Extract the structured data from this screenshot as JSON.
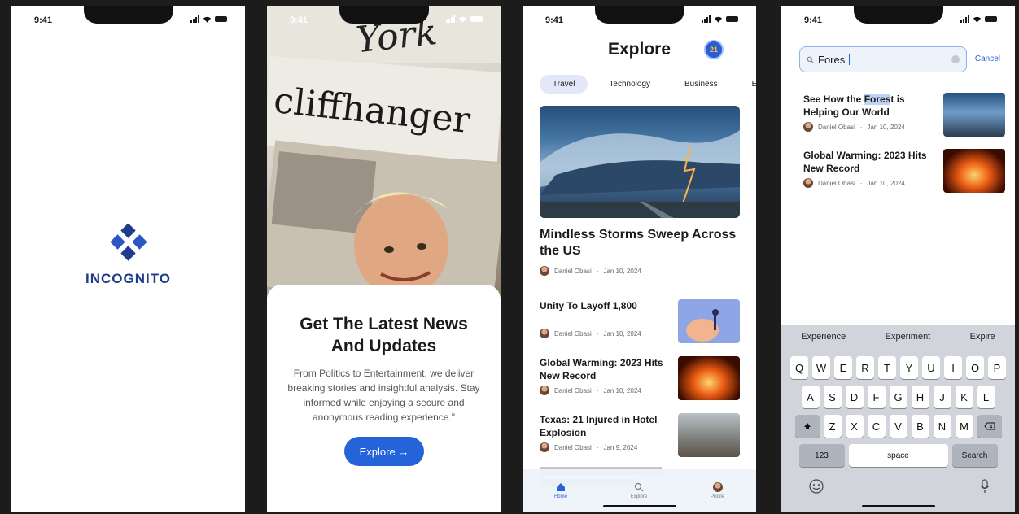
{
  "status": {
    "time": "9:41"
  },
  "splash": {
    "brand": "INCOGNITO",
    "brand_color": "#1f3b8c"
  },
  "onboarding": {
    "headline": "Get The Latest News And Updates",
    "body": "From Politics to Entertainment, we deliver breaking stories and insightful analysis. Stay informed while enjoying a secure and anonymous reading experience.\"",
    "cta_label": "Explore →",
    "paper_words": [
      "cliffhanger",
      "York"
    ]
  },
  "explore": {
    "title": "Explore",
    "badge": "21",
    "tabs": [
      "Travel",
      "Technology",
      "Business",
      "E"
    ],
    "hero": {
      "title": "Mindless Storms Sweep Across the US",
      "author": "Daniel Obasi",
      "date": "Jan 10, 2024"
    },
    "articles": [
      {
        "title": "Unity To Layoff 1,800",
        "author": "Daniel Obasi",
        "date": "Jan 10, 2024"
      },
      {
        "title": "Global Warming: 2023 Hits New Record",
        "author": "Daniel Obasi",
        "date": "Jan 10, 2024"
      },
      {
        "title": "Texas: 21 Injured in Hotel Explosion",
        "author": "Daniel Obasi",
        "date": "Jan 9, 2024"
      }
    ],
    "nav": [
      {
        "label": "Home",
        "icon": "home-icon",
        "active": true
      },
      {
        "label": "Explore",
        "icon": "search-icon",
        "active": false
      },
      {
        "label": "Profile",
        "icon": "profile-icon",
        "active": false
      }
    ]
  },
  "search": {
    "query": "Fores",
    "cancel": "Cancel",
    "results": [
      {
        "title_pre": "See How the ",
        "title_hl": "Fores",
        "title_post": "t is Helping Our World",
        "author": "Daniel Obasi",
        "date": "Jan 10, 2024"
      },
      {
        "title_pre": "Global Warming: 2023 Hits New Record",
        "title_hl": "",
        "title_post": "",
        "author": "Daniel Obasi",
        "date": "Jan 10, 2024"
      }
    ],
    "suggestions": [
      "Experience",
      "Experiment",
      "Expire"
    ],
    "rows": [
      [
        "Q",
        "W",
        "E",
        "R",
        "T",
        "Y",
        "U",
        "I",
        "O",
        "P"
      ],
      [
        "A",
        "S",
        "D",
        "F",
        "G",
        "H",
        "J",
        "K",
        "L"
      ],
      [
        "Z",
        "X",
        "C",
        "V",
        "B",
        "N",
        "M"
      ]
    ],
    "key_123": "123",
    "key_space": "space",
    "key_search": "Search"
  },
  "colors": {
    "accent": "#2563d8"
  }
}
